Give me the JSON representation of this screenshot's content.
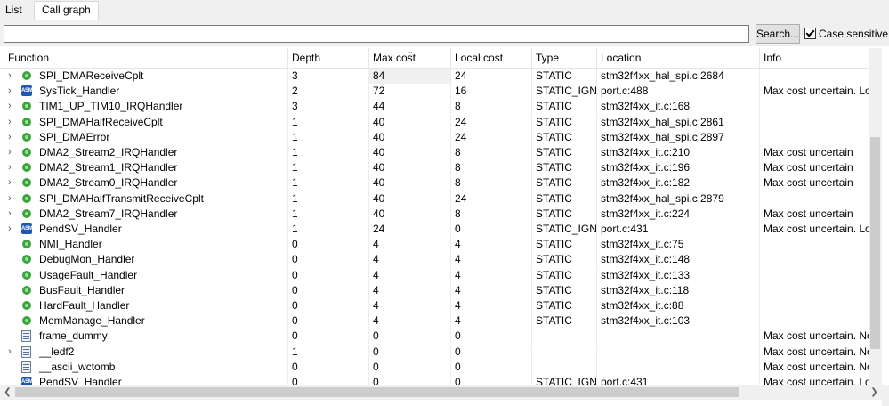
{
  "tabs": {
    "list": "List",
    "call_graph": "Call graph"
  },
  "search": {
    "placeholder": "",
    "value": "",
    "button": "Search...",
    "case_label": "Case sensitive"
  },
  "columns": {
    "function": "Function",
    "depth": "Depth",
    "max_cost": "Max cost",
    "local_cost": "Local cost",
    "type": "Type",
    "location": "Location",
    "info": "Info"
  },
  "rows": [
    {
      "name": "SPI_DMAReceiveCplt",
      "icon": "fn",
      "expand": true,
      "depth": "3",
      "max": "84",
      "local": "24",
      "type": "STATIC",
      "loc": "stm32f4xx_hal_spi.c:2684",
      "info": ""
    },
    {
      "name": "SysTick_Handler",
      "icon": "asm",
      "expand": true,
      "depth": "2",
      "max": "72",
      "local": "16",
      "type": "STATIC_IGN...",
      "loc": "port.c:488",
      "info": "Max cost uncertain. Loc"
    },
    {
      "name": "TIM1_UP_TIM10_IRQHandler",
      "icon": "fn",
      "expand": true,
      "depth": "3",
      "max": "44",
      "local": "8",
      "type": "STATIC",
      "loc": "stm32f4xx_it.c:168",
      "info": ""
    },
    {
      "name": "SPI_DMAHalfReceiveCplt",
      "icon": "fn",
      "expand": true,
      "depth": "1",
      "max": "40",
      "local": "24",
      "type": "STATIC",
      "loc": "stm32f4xx_hal_spi.c:2861",
      "info": ""
    },
    {
      "name": "SPI_DMAError",
      "icon": "fn",
      "expand": true,
      "depth": "1",
      "max": "40",
      "local": "24",
      "type": "STATIC",
      "loc": "stm32f4xx_hal_spi.c:2897",
      "info": ""
    },
    {
      "name": "DMA2_Stream2_IRQHandler",
      "icon": "fn",
      "expand": true,
      "depth": "1",
      "max": "40",
      "local": "8",
      "type": "STATIC",
      "loc": "stm32f4xx_it.c:210",
      "info": "Max cost uncertain"
    },
    {
      "name": "DMA2_Stream1_IRQHandler",
      "icon": "fn",
      "expand": true,
      "depth": "1",
      "max": "40",
      "local": "8",
      "type": "STATIC",
      "loc": "stm32f4xx_it.c:196",
      "info": "Max cost uncertain"
    },
    {
      "name": "DMA2_Stream0_IRQHandler",
      "icon": "fn",
      "expand": true,
      "depth": "1",
      "max": "40",
      "local": "8",
      "type": "STATIC",
      "loc": "stm32f4xx_it.c:182",
      "info": "Max cost uncertain"
    },
    {
      "name": "SPI_DMAHalfTransmitReceiveCplt",
      "icon": "fn",
      "expand": true,
      "depth": "1",
      "max": "40",
      "local": "24",
      "type": "STATIC",
      "loc": "stm32f4xx_hal_spi.c:2879",
      "info": ""
    },
    {
      "name": "DMA2_Stream7_IRQHandler",
      "icon": "fn",
      "expand": true,
      "depth": "1",
      "max": "40",
      "local": "8",
      "type": "STATIC",
      "loc": "stm32f4xx_it.c:224",
      "info": "Max cost uncertain"
    },
    {
      "name": "PendSV_Handler",
      "icon": "asm",
      "expand": true,
      "depth": "1",
      "max": "24",
      "local": "0",
      "type": "STATIC_IGN...",
      "loc": "port.c:431",
      "info": "Max cost uncertain. Loc"
    },
    {
      "name": "NMI_Handler",
      "icon": "fn",
      "expand": false,
      "depth": "0",
      "max": "4",
      "local": "4",
      "type": "STATIC",
      "loc": "stm32f4xx_it.c:75",
      "info": ""
    },
    {
      "name": "DebugMon_Handler",
      "icon": "fn",
      "expand": false,
      "depth": "0",
      "max": "4",
      "local": "4",
      "type": "STATIC",
      "loc": "stm32f4xx_it.c:148",
      "info": ""
    },
    {
      "name": "UsageFault_Handler",
      "icon": "fn",
      "expand": false,
      "depth": "0",
      "max": "4",
      "local": "4",
      "type": "STATIC",
      "loc": "stm32f4xx_it.c:133",
      "info": ""
    },
    {
      "name": "BusFault_Handler",
      "icon": "fn",
      "expand": false,
      "depth": "0",
      "max": "4",
      "local": "4",
      "type": "STATIC",
      "loc": "stm32f4xx_it.c:118",
      "info": ""
    },
    {
      "name": "HardFault_Handler",
      "icon": "fn",
      "expand": false,
      "depth": "0",
      "max": "4",
      "local": "4",
      "type": "STATIC",
      "loc": "stm32f4xx_it.c:88",
      "info": ""
    },
    {
      "name": "MemManage_Handler",
      "icon": "fn",
      "expand": false,
      "depth": "0",
      "max": "4",
      "local": "4",
      "type": "STATIC",
      "loc": "stm32f4xx_it.c:103",
      "info": ""
    },
    {
      "name": "frame_dummy",
      "icon": "bin",
      "expand": false,
      "depth": "0",
      "max": "0",
      "local": "0",
      "type": "",
      "loc": "",
      "info": "Max cost uncertain. No"
    },
    {
      "name": "__ledf2",
      "icon": "bin",
      "expand": true,
      "depth": "1",
      "max": "0",
      "local": "0",
      "type": "",
      "loc": "",
      "info": "Max cost uncertain. No"
    },
    {
      "name": "__ascii_wctomb",
      "icon": "bin",
      "expand": false,
      "depth": "0",
      "max": "0",
      "local": "0",
      "type": "",
      "loc": "",
      "info": "Max cost uncertain. No"
    },
    {
      "name": "PendSV_Handler",
      "icon": "asm",
      "expand": false,
      "depth": "0",
      "max": "0",
      "local": "0",
      "type": "STATIC_IGN...",
      "loc": "port.c:431",
      "info": "Max cost uncertain. Loc"
    }
  ],
  "icons": {
    "fn": "function-icon",
    "asm": "asm-icon",
    "bin": "binary-file-icon",
    "asm_text": "ASM",
    "expand": "chevron-right-icon"
  }
}
